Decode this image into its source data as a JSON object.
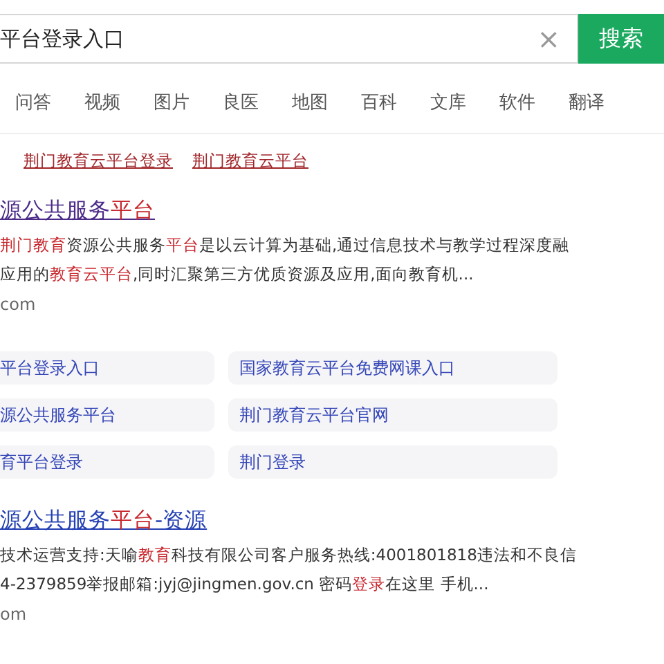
{
  "search": {
    "value": "平台登录入口",
    "clear": "×",
    "button": "搜索"
  },
  "tabs": [
    {
      "label": "问答",
      "selected": false
    },
    {
      "label": "视频",
      "selected": false
    },
    {
      "label": "图片",
      "selected": false
    },
    {
      "label": "良医",
      "selected": false
    },
    {
      "label": "地图",
      "selected": false
    },
    {
      "label": "百科",
      "selected": false
    },
    {
      "label": "文库",
      "selected": false
    },
    {
      "label": "软件",
      "selected": false
    },
    {
      "label": "翻译",
      "selected": false
    }
  ],
  "related_links": [
    "荆门教育云平台登录",
    "荆门教育云平台"
  ],
  "results": [
    {
      "visited": true,
      "title": [
        {
          "text": "源公共服务",
          "highlight": false
        },
        {
          "text": "平台",
          "highlight": true
        }
      ],
      "snippet": [
        [
          {
            "text": "荆门教育",
            "highlight": true
          },
          {
            "text": "资源公共服务",
            "highlight": false
          },
          {
            "text": "平台",
            "highlight": true
          },
          {
            "text": "是以云计算为基础,通过信息技术与教学过程深度融",
            "highlight": false
          }
        ],
        [
          {
            "text": "应用的",
            "highlight": false
          },
          {
            "text": "教育云平台",
            "highlight": true
          },
          {
            "text": ",同时汇聚第三方优质资源及应用,面向教育机...",
            "highlight": false
          }
        ]
      ],
      "url": "com",
      "related_searches": [
        "平台登录入口",
        "国家教育云平台免费网课入口",
        "源公共服务平台",
        "荆门教育云平台官网",
        "育平台登录",
        "荆门登录"
      ]
    },
    {
      "visited": false,
      "title": [
        {
          "text": "源公共服务",
          "highlight": false
        },
        {
          "text": "平台",
          "highlight": true
        },
        {
          "text": "-资源",
          "highlight": false
        }
      ],
      "snippet": [
        [
          {
            "text": "技术运营支持:天喻",
            "highlight": false
          },
          {
            "text": "教育",
            "highlight": true
          },
          {
            "text": "科技有限公司客户服务热线:4001801818违法和不良信",
            "highlight": false
          }
        ],
        [
          {
            "text": "4-2379859举报邮箱:jyj@jingmen.gov.cn 密码",
            "highlight": false
          },
          {
            "text": "登录",
            "highlight": true
          },
          {
            "text": "在这里 手机...",
            "highlight": false
          }
        ]
      ],
      "url": "om"
    }
  ]
}
